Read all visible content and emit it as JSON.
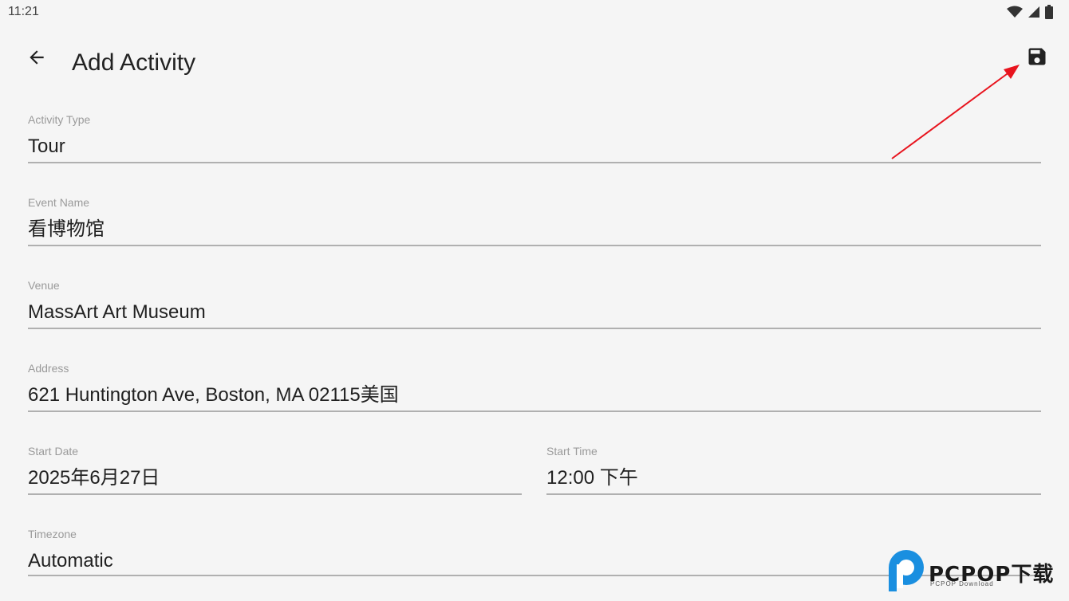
{
  "status_bar": {
    "time": "11:21",
    "icons": [
      "wifi-icon",
      "signal-icon",
      "battery-icon"
    ]
  },
  "appbar": {
    "title": "Add Activity",
    "back_icon": "arrow-back-icon",
    "save_icon": "save-icon"
  },
  "form": {
    "activity_type": {
      "label": "Activity Type",
      "value": "Tour"
    },
    "event_name": {
      "label": "Event Name",
      "value": "看博物馆"
    },
    "venue": {
      "label": "Venue",
      "value": "MassArt Art Museum"
    },
    "address": {
      "label": "Address",
      "value": "621 Huntington Ave, Boston, MA 02115美国"
    },
    "start_date": {
      "label": "Start Date",
      "value": "2025年6月27日"
    },
    "start_time": {
      "label": "Start Time",
      "value": "12:00 下午"
    },
    "timezone": {
      "label": "Timezone",
      "value": "Automatic"
    }
  },
  "watermark": {
    "text": "PCPOP下载",
    "subtext": "PCPOP Download"
  },
  "colors": {
    "annotation_arrow": "#e8141e",
    "watermark_blue": "#1a8fe0"
  }
}
